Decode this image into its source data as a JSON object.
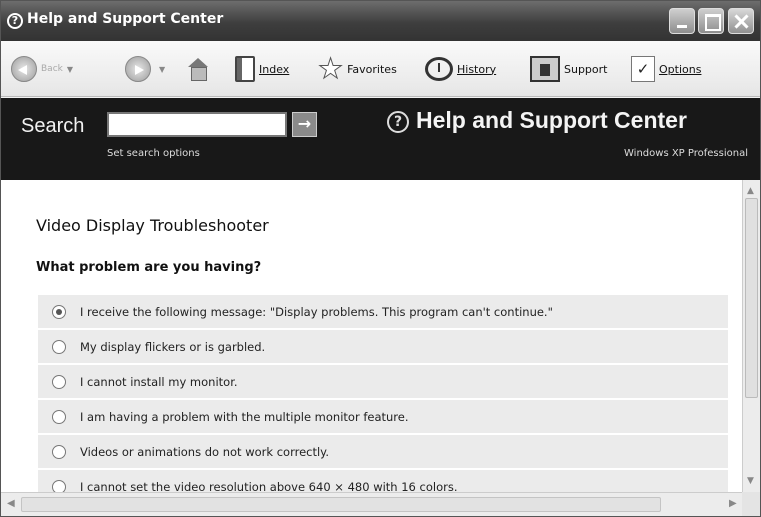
{
  "window": {
    "title": "Help and Support Center",
    "app_icon": "?"
  },
  "toolbar": {
    "back": "Back",
    "index": "Index",
    "favorites": "Favorites",
    "history": "History",
    "support": "Support",
    "options": "Options"
  },
  "header": {
    "search_label": "Search",
    "search_value": "",
    "search_go": "→",
    "search_options": "Set search options",
    "help_icon": "?",
    "title": "Help and Support Center",
    "edition": "Windows XP Professional"
  },
  "content": {
    "page_title": "Video Display Troubleshooter",
    "question": "What problem are you having?",
    "options": [
      {
        "label": "I receive the following message: \"Display problems. This program can't continue.\"",
        "checked": true
      },
      {
        "label": "My display flickers or is garbled.",
        "checked": false
      },
      {
        "label": "I cannot install my monitor.",
        "checked": false
      },
      {
        "label": "I am having a problem with the multiple monitor feature.",
        "checked": false
      },
      {
        "label": "Videos or animations do not work correctly.",
        "checked": false
      },
      {
        "label": "I cannot set the video resolution above 640 × 480 with 16 colors.",
        "checked": false
      }
    ]
  },
  "scroll": {
    "up": "▲",
    "down": "▼",
    "left": "◀",
    "right": "▶"
  }
}
